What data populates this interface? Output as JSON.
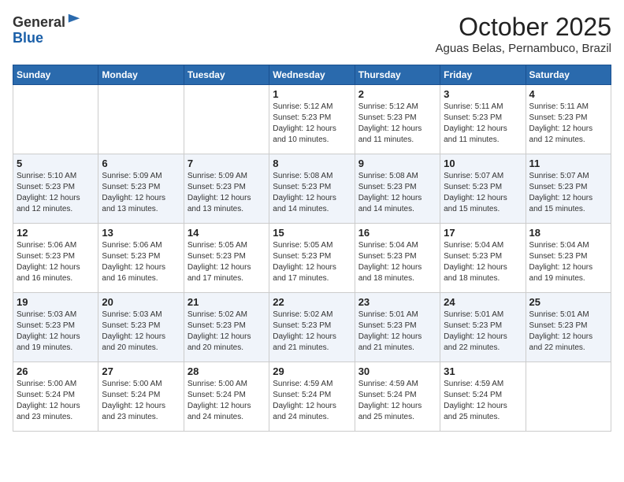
{
  "header": {
    "logo_general": "General",
    "logo_blue": "Blue",
    "month_title": "October 2025",
    "location": "Aguas Belas, Pernambuco, Brazil"
  },
  "days_of_week": [
    "Sunday",
    "Monday",
    "Tuesday",
    "Wednesday",
    "Thursday",
    "Friday",
    "Saturday"
  ],
  "weeks": [
    [
      {
        "day": "",
        "text": ""
      },
      {
        "day": "",
        "text": ""
      },
      {
        "day": "",
        "text": ""
      },
      {
        "day": "1",
        "text": "Sunrise: 5:12 AM\nSunset: 5:23 PM\nDaylight: 12 hours\nand 10 minutes."
      },
      {
        "day": "2",
        "text": "Sunrise: 5:12 AM\nSunset: 5:23 PM\nDaylight: 12 hours\nand 11 minutes."
      },
      {
        "day": "3",
        "text": "Sunrise: 5:11 AM\nSunset: 5:23 PM\nDaylight: 12 hours\nand 11 minutes."
      },
      {
        "day": "4",
        "text": "Sunrise: 5:11 AM\nSunset: 5:23 PM\nDaylight: 12 hours\nand 12 minutes."
      }
    ],
    [
      {
        "day": "5",
        "text": "Sunrise: 5:10 AM\nSunset: 5:23 PM\nDaylight: 12 hours\nand 12 minutes."
      },
      {
        "day": "6",
        "text": "Sunrise: 5:09 AM\nSunset: 5:23 PM\nDaylight: 12 hours\nand 13 minutes."
      },
      {
        "day": "7",
        "text": "Sunrise: 5:09 AM\nSunset: 5:23 PM\nDaylight: 12 hours\nand 13 minutes."
      },
      {
        "day": "8",
        "text": "Sunrise: 5:08 AM\nSunset: 5:23 PM\nDaylight: 12 hours\nand 14 minutes."
      },
      {
        "day": "9",
        "text": "Sunrise: 5:08 AM\nSunset: 5:23 PM\nDaylight: 12 hours\nand 14 minutes."
      },
      {
        "day": "10",
        "text": "Sunrise: 5:07 AM\nSunset: 5:23 PM\nDaylight: 12 hours\nand 15 minutes."
      },
      {
        "day": "11",
        "text": "Sunrise: 5:07 AM\nSunset: 5:23 PM\nDaylight: 12 hours\nand 15 minutes."
      }
    ],
    [
      {
        "day": "12",
        "text": "Sunrise: 5:06 AM\nSunset: 5:23 PM\nDaylight: 12 hours\nand 16 minutes."
      },
      {
        "day": "13",
        "text": "Sunrise: 5:06 AM\nSunset: 5:23 PM\nDaylight: 12 hours\nand 16 minutes."
      },
      {
        "day": "14",
        "text": "Sunrise: 5:05 AM\nSunset: 5:23 PM\nDaylight: 12 hours\nand 17 minutes."
      },
      {
        "day": "15",
        "text": "Sunrise: 5:05 AM\nSunset: 5:23 PM\nDaylight: 12 hours\nand 17 minutes."
      },
      {
        "day": "16",
        "text": "Sunrise: 5:04 AM\nSunset: 5:23 PM\nDaylight: 12 hours\nand 18 minutes."
      },
      {
        "day": "17",
        "text": "Sunrise: 5:04 AM\nSunset: 5:23 PM\nDaylight: 12 hours\nand 18 minutes."
      },
      {
        "day": "18",
        "text": "Sunrise: 5:04 AM\nSunset: 5:23 PM\nDaylight: 12 hours\nand 19 minutes."
      }
    ],
    [
      {
        "day": "19",
        "text": "Sunrise: 5:03 AM\nSunset: 5:23 PM\nDaylight: 12 hours\nand 19 minutes."
      },
      {
        "day": "20",
        "text": "Sunrise: 5:03 AM\nSunset: 5:23 PM\nDaylight: 12 hours\nand 20 minutes."
      },
      {
        "day": "21",
        "text": "Sunrise: 5:02 AM\nSunset: 5:23 PM\nDaylight: 12 hours\nand 20 minutes."
      },
      {
        "day": "22",
        "text": "Sunrise: 5:02 AM\nSunset: 5:23 PM\nDaylight: 12 hours\nand 21 minutes."
      },
      {
        "day": "23",
        "text": "Sunrise: 5:01 AM\nSunset: 5:23 PM\nDaylight: 12 hours\nand 21 minutes."
      },
      {
        "day": "24",
        "text": "Sunrise: 5:01 AM\nSunset: 5:23 PM\nDaylight: 12 hours\nand 22 minutes."
      },
      {
        "day": "25",
        "text": "Sunrise: 5:01 AM\nSunset: 5:23 PM\nDaylight: 12 hours\nand 22 minutes."
      }
    ],
    [
      {
        "day": "26",
        "text": "Sunrise: 5:00 AM\nSunset: 5:24 PM\nDaylight: 12 hours\nand 23 minutes."
      },
      {
        "day": "27",
        "text": "Sunrise: 5:00 AM\nSunset: 5:24 PM\nDaylight: 12 hours\nand 23 minutes."
      },
      {
        "day": "28",
        "text": "Sunrise: 5:00 AM\nSunset: 5:24 PM\nDaylight: 12 hours\nand 24 minutes."
      },
      {
        "day": "29",
        "text": "Sunrise: 4:59 AM\nSunset: 5:24 PM\nDaylight: 12 hours\nand 24 minutes."
      },
      {
        "day": "30",
        "text": "Sunrise: 4:59 AM\nSunset: 5:24 PM\nDaylight: 12 hours\nand 25 minutes."
      },
      {
        "day": "31",
        "text": "Sunrise: 4:59 AM\nSunset: 5:24 PM\nDaylight: 12 hours\nand 25 minutes."
      },
      {
        "day": "",
        "text": ""
      }
    ]
  ]
}
